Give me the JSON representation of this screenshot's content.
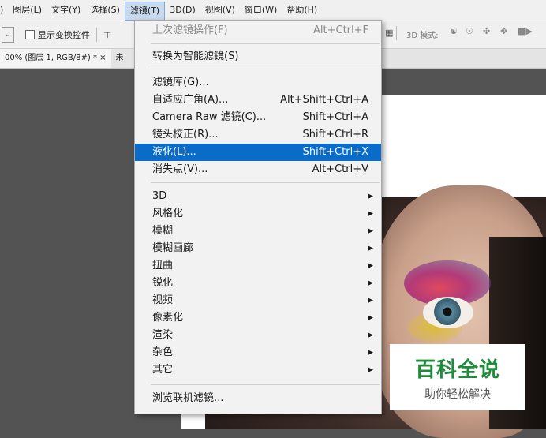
{
  "menubar": {
    "items": [
      ")",
      "图层(L)",
      "文字(Y)",
      "选择(S)",
      "滤镜(T)",
      "3D(D)",
      "视图(V)",
      "窗口(W)",
      "帮助(H)"
    ]
  },
  "options": {
    "show_transform_label": "显示变换控件",
    "mode3d_label": "3D 模式:"
  },
  "tabs": {
    "active": "00% (图层 1, RGB/8#) * ×",
    "next": "未"
  },
  "filter_menu": {
    "last_filter": {
      "label": "上次滤镜操作(F)",
      "shortcut": "Alt+Ctrl+F"
    },
    "convert_smart": {
      "label": "转换为智能滤镜(S)"
    },
    "gallery": {
      "label": "滤镜库(G)..."
    },
    "adaptive_wide": {
      "label": "自适应广角(A)...",
      "shortcut": "Alt+Shift+Ctrl+A"
    },
    "camera_raw": {
      "label": "Camera Raw 滤镜(C)...",
      "shortcut": "Shift+Ctrl+A"
    },
    "lens_correction": {
      "label": "镜头校正(R)...",
      "shortcut": "Shift+Ctrl+R"
    },
    "liquify": {
      "label": "液化(L)...",
      "shortcut": "Shift+Ctrl+X"
    },
    "vanishing_point": {
      "label": "消失点(V)...",
      "shortcut": "Alt+Ctrl+V"
    },
    "submenus": [
      "3D",
      "风格化",
      "模糊",
      "模糊画廊",
      "扭曲",
      "锐化",
      "视频",
      "像素化",
      "渲染",
      "杂色",
      "其它"
    ],
    "browse_online": {
      "label": "浏览联机滤镜..."
    }
  },
  "watermark": {
    "title": "百科全说",
    "subtitle": "助你轻松解决"
  },
  "colors": {
    "highlight": "#0a6bc9",
    "watermark_green": "#1f8c3c"
  }
}
